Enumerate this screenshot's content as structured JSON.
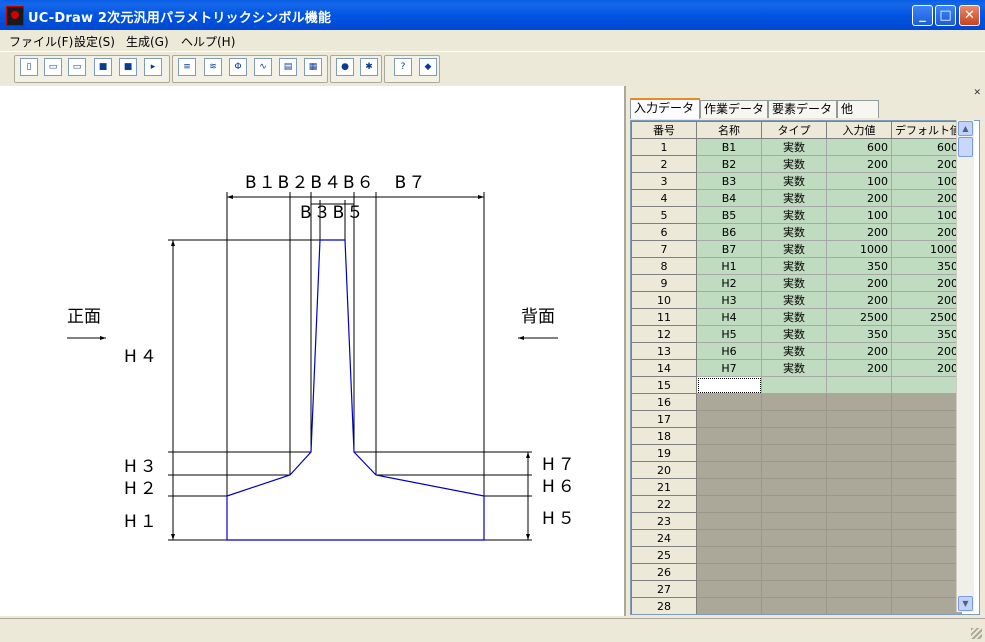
{
  "window": {
    "title": "UC-Draw 2次元汎用パラメトリックシンボル機能",
    "min_glyph": "_",
    "max_glyph": "□",
    "close_glyph": "✕"
  },
  "menu": [
    "ファイル(F)",
    "設定(S)",
    "生成(G)",
    "ヘルプ(H)"
  ],
  "toolbar_icons": [
    "new-icon",
    "open-icon",
    "open-folder-icon",
    "save-icon",
    "save-as-icon",
    "export-icon",
    "list-icon",
    "layers-icon",
    "symbol-icon",
    "curve-icon",
    "print-icon",
    "table-icon",
    "info-icon",
    "settings-icon",
    "help-icon",
    "about-icon"
  ],
  "drawing": {
    "top_dims": "B１B２B４B６　B７",
    "top_dims2": "B３B５",
    "left_label": "正面",
    "right_label": "背面",
    "h4": "H４",
    "h3": "H３",
    "h2": "H２",
    "h1": "H１",
    "h7": "H７",
    "h6": "H６",
    "h5": "H５"
  },
  "panel": {
    "close_glyph": "✕",
    "tabs": [
      "入力データ",
      "作業データ",
      "要素データ",
      "他"
    ],
    "columns": [
      "番号",
      "名称",
      "タイプ",
      "入力値",
      "デフォルト値"
    ],
    "rows": [
      {
        "no": "1",
        "name": "B1",
        "type": "実数",
        "input": "600",
        "default": "600"
      },
      {
        "no": "2",
        "name": "B2",
        "type": "実数",
        "input": "200",
        "default": "200"
      },
      {
        "no": "3",
        "name": "B3",
        "type": "実数",
        "input": "100",
        "default": "100"
      },
      {
        "no": "4",
        "name": "B4",
        "type": "実数",
        "input": "200",
        "default": "200"
      },
      {
        "no": "5",
        "name": "B5",
        "type": "実数",
        "input": "100",
        "default": "100"
      },
      {
        "no": "6",
        "name": "B6",
        "type": "実数",
        "input": "200",
        "default": "200"
      },
      {
        "no": "7",
        "name": "B7",
        "type": "実数",
        "input": "1000",
        "default": "1000"
      },
      {
        "no": "8",
        "name": "H1",
        "type": "実数",
        "input": "350",
        "default": "350"
      },
      {
        "no": "9",
        "name": "H2",
        "type": "実数",
        "input": "200",
        "default": "200"
      },
      {
        "no": "10",
        "name": "H3",
        "type": "実数",
        "input": "200",
        "default": "200"
      },
      {
        "no": "11",
        "name": "H4",
        "type": "実数",
        "input": "2500",
        "default": "2500"
      },
      {
        "no": "12",
        "name": "H5",
        "type": "実数",
        "input": "350",
        "default": "350"
      },
      {
        "no": "13",
        "name": "H6",
        "type": "実数",
        "input": "200",
        "default": "200"
      },
      {
        "no": "14",
        "name": "H7",
        "type": "実数",
        "input": "200",
        "default": "200"
      }
    ],
    "empty_row_numbers": [
      "15",
      "16",
      "17",
      "18",
      "19",
      "20",
      "21",
      "22",
      "23",
      "24",
      "25",
      "26",
      "27",
      "28"
    ]
  },
  "colors": {
    "profile": "#0000cc",
    "input_cell": "#c0dcc0",
    "empty_cell": "#aca899"
  }
}
